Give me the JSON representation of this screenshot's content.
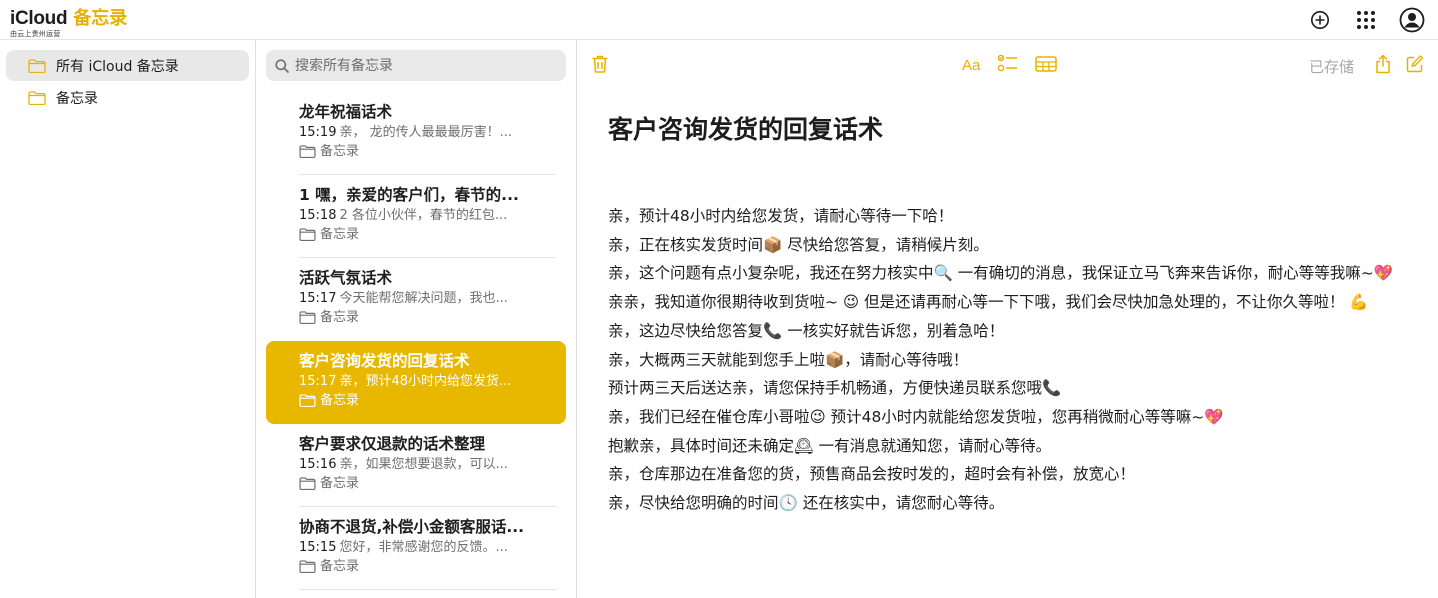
{
  "header": {
    "brand_name": "iCloud",
    "brand_app": "备忘录",
    "brand_sub": "由云上贵州运营"
  },
  "sidebar": {
    "folders": [
      {
        "label": "所有 iCloud 备忘录",
        "active": true
      },
      {
        "label": "备忘录",
        "active": false
      }
    ]
  },
  "search": {
    "placeholder": "搜索所有备忘录"
  },
  "notes": [
    {
      "title": "龙年祝福话术",
      "time": "15:19",
      "preview": "亲，  龙的传人最最最厉害！...",
      "folder": "备忘录"
    },
    {
      "title": "1 嘿，亲爱的客户们，春节的...",
      "time": "15:18",
      "preview": "2 各位小伙伴，春节的红包...",
      "folder": "备忘录"
    },
    {
      "title": "活跃气氛话术",
      "time": "15:17",
      "preview": "今天能帮您解决问题，我也...",
      "folder": "备忘录"
    },
    {
      "title": "客户咨询发货的回复话术",
      "time": "15:17",
      "preview": "亲，预计48小时内给您发货...",
      "folder": "备忘录",
      "selected": true
    },
    {
      "title": "客户要求仅退款的话术整理",
      "time": "15:16",
      "preview": "亲，如果您想要退款，可以...",
      "folder": "备忘录"
    },
    {
      "title": "协商不退货,补偿小金额客服话...",
      "time": "15:15",
      "preview": "您好，非常感谢您的反馈。...",
      "folder": "备忘录"
    }
  ],
  "editor": {
    "saved_status": "已存储",
    "title": "客户咨询发货的回复话术",
    "lines": [
      "亲，预计48小时内给您发货，请耐心等待一下哈！",
      "亲，正在核实发货时间📦 尽快给您答复，请稍候片刻。",
      "亲，这个问题有点小复杂呢，我还在努力核实中🔍 一有确切的消息，我保证立马飞奔来告诉你，耐心等等我嘛~💖",
      "亲亲，我知道你很期待收到货啦~ 😉 但是还请再耐心等一下下哦，我们会尽快加急处理的，不让你久等啦！ 💪",
      "亲，这边尽快给您答复📞 一核实好就告诉您，别着急哈！",
      "亲，大概两三天就能到您手上啦📦，请耐心等待哦！",
      "预计两三天后送达亲，请您保持手机畅通，方便快递员联系您哦📞",
      "亲，我们已经在催仓库小哥啦😉 预计48小时内就能给您发货啦，您再稍微耐心等等嘛~💖",
      "抱歉亲，具体时间还未确定🕰 一有消息就通知您，请耐心等待。",
      "亲，仓库那边在准备您的货，预售商品会按时发的，超时会有补偿，放宽心！",
      "亲，尽快给您明确的时间🕓 还在核实中，请您耐心等待。"
    ]
  },
  "colors": {
    "accent": "#e8b800",
    "icon_accent": "#e8b000"
  }
}
